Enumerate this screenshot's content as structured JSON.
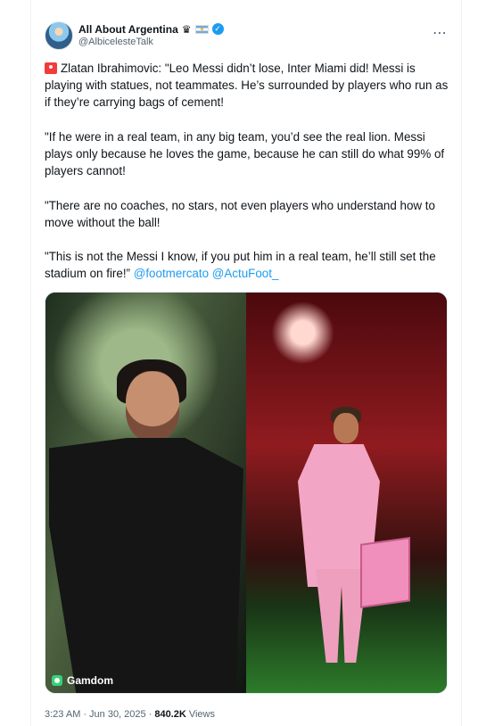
{
  "account": {
    "display_name": "All About Argentina",
    "handle": "@AlbicelesteTalk",
    "icons": [
      "crown-icon",
      "argentina-flag-icon",
      "verified-badge-icon"
    ]
  },
  "tweet": {
    "paragraph_1": "Zlatan Ibrahimovic: \"Leo Messi didn’t lose, Inter Miami did! Messi is playing with statues, not teammates. He’s surrounded by players who run as if they’re carrying bags of cement!",
    "paragraph_2": "\"If he were in a real team, in any big team, you’d see the real lion. Messi plays only because he loves the game, because he can still do what 99% of players cannot!",
    "paragraph_3": "\"There are no coaches, no stars, not even players who understand how to move without the ball!",
    "paragraph_4": "\"This is not the Messi I know, if you put him in a real team, he’ll still set the stadium on fire!” ",
    "mentions": [
      "@footmercato",
      "@ActuFoot_"
    ]
  },
  "media": {
    "watermark": "Gamdom"
  },
  "meta": {
    "time": "3:23 AM",
    "separator": "·",
    "date": "Jun 30, 2025",
    "views_count": "840.2K",
    "views_label": "Views"
  },
  "colors": {
    "text_primary": "#0f1419",
    "text_secondary": "#536471",
    "link": "#1d9bf0",
    "border": "#eff3f4"
  }
}
